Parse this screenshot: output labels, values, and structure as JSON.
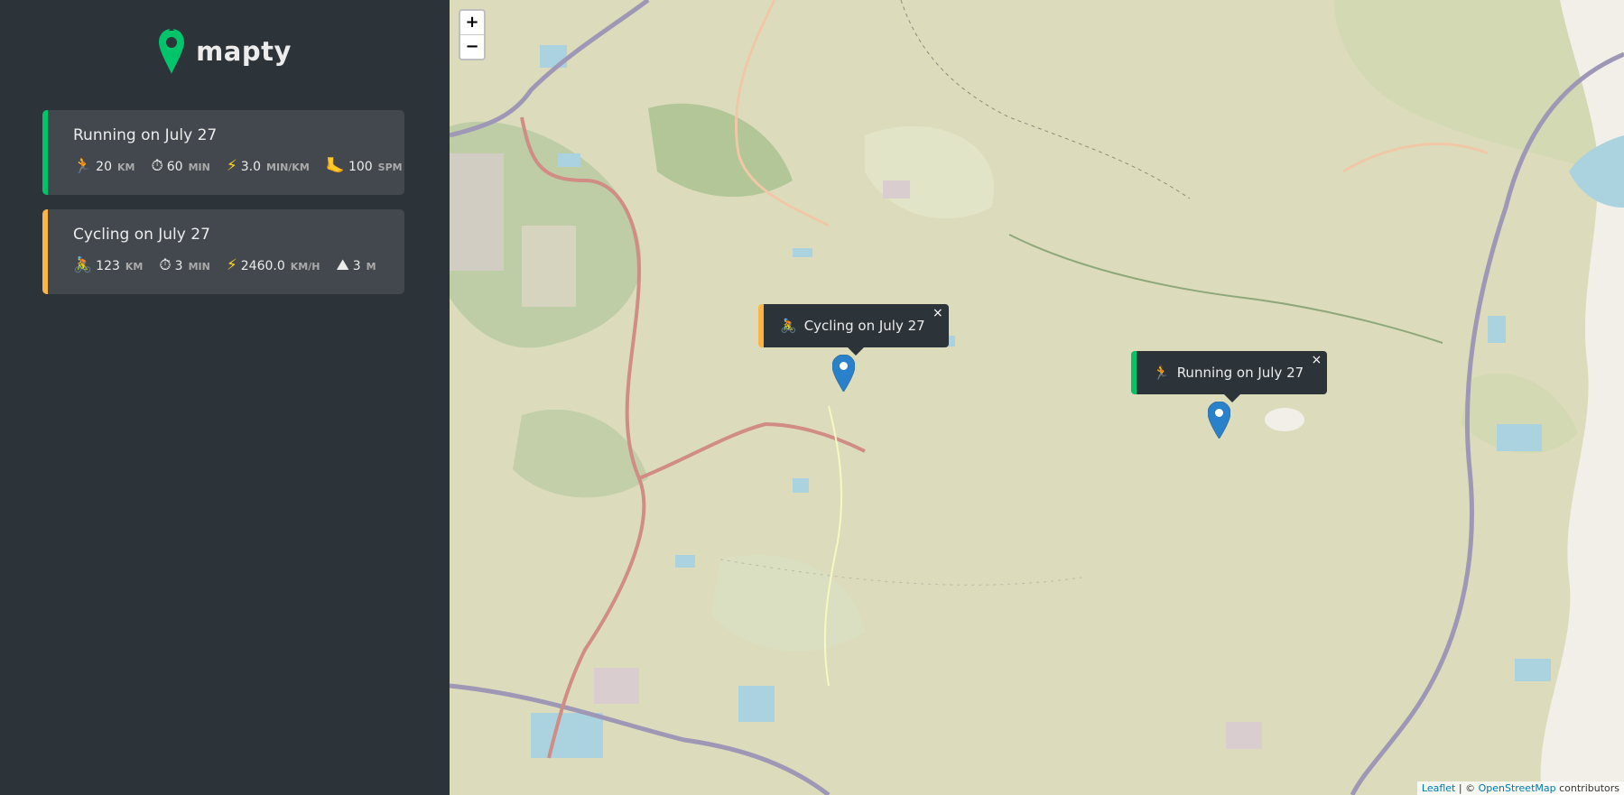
{
  "app": {
    "name": "mapty"
  },
  "workouts": [
    {
      "type": "running",
      "title": "Running on July 27",
      "details": [
        {
          "icon": "running-icon",
          "glyph": "🏃",
          "value": "20",
          "unit": "km"
        },
        {
          "icon": "stopwatch-icon",
          "glyph": "⏱",
          "value": "60",
          "unit": "min"
        },
        {
          "icon": "lightning-icon",
          "glyph": "⚡",
          "value": "3.0",
          "unit": "min/km"
        },
        {
          "icon": "footprint-icon",
          "glyph": "🦶",
          "value": "100",
          "unit": "spm"
        }
      ]
    },
    {
      "type": "cycling",
      "title": "Cycling on July 27",
      "details": [
        {
          "icon": "cycling-icon",
          "glyph": "🚴",
          "value": "123",
          "unit": "km"
        },
        {
          "icon": "stopwatch-icon",
          "glyph": "⏱",
          "value": "3",
          "unit": "min"
        },
        {
          "icon": "lightning-icon",
          "glyph": "⚡",
          "value": "2460.0",
          "unit": "km/h"
        },
        {
          "icon": "mountain-icon",
          "glyph": "⛰",
          "value": "3",
          "unit": "m"
        }
      ]
    }
  ],
  "map": {
    "zoom_in": "+",
    "zoom_out": "−",
    "popups": [
      {
        "type": "cycling",
        "glyph": "🚴",
        "label": "Cycling on July 27",
        "close": "×"
      },
      {
        "type": "running",
        "glyph": "🏃",
        "label": "Running on July 27",
        "close": "×"
      }
    ],
    "attribution": {
      "leaflet": "Leaflet",
      "sep": " | © ",
      "osm": "OpenStreetMap",
      "suffix": " contributors"
    }
  },
  "colors": {
    "running": "#00c46a",
    "cycling": "#ffb545",
    "sidebar": "#2d3439",
    "card": "#42484d"
  }
}
